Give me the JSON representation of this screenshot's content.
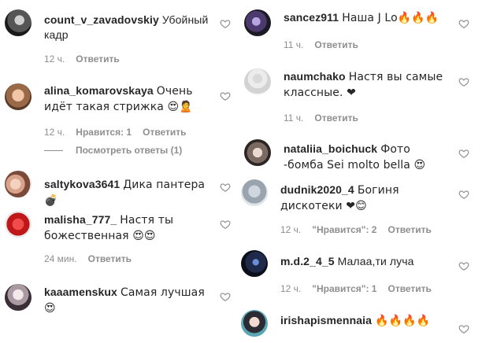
{
  "left_column": [
    {
      "username": "count_v_zavadovskiy",
      "text": "Убойный кадр",
      "time": "12 ч.",
      "likes": "",
      "reply": "Ответить"
    },
    {
      "username": "alina_komarovskaya",
      "text": "Очень идёт такая стрижка 😍🙎",
      "time": "12 ч.",
      "likes": "Нравится: 1",
      "reply": "Ответить",
      "view_replies": "Посмотреть ответы (1)"
    },
    {
      "username": "saltykova3641",
      "text": "Дика пантера💣",
      "time": "",
      "likes": "",
      "reply": ""
    },
    {
      "username": "malisha_777_",
      "text": "Настя ты божественная 😍😍",
      "time": "24 мин.",
      "likes": "",
      "reply": "Ответить"
    },
    {
      "username": "kaaamenskux",
      "text": "Самая лучшая 😍",
      "time": "",
      "likes": "",
      "reply": ""
    }
  ],
  "right_column": [
    {
      "username": "sancez911",
      "text": "Наша J Lo🔥🔥🔥",
      "time": "11 ч.",
      "likes": "",
      "reply": "Ответить"
    },
    {
      "username": "naumchako",
      "text": "Настя вы самые классные. ❤",
      "time": "11 ч.",
      "likes": "",
      "reply": "Ответить"
    },
    {
      "username": "nataliia_boichuck",
      "text": "Фото -бомба Sei molto bella 😍",
      "time": "",
      "likes": "",
      "reply": ""
    },
    {
      "username": "dudnik2020_4",
      "text": "Богиня дискотеки ❤😊",
      "time": "12 ч.",
      "likes": "\"Нравится\": 2",
      "reply": "Ответить"
    },
    {
      "username": "m.d.2_4_5",
      "text": "Малаа,ти луча",
      "time": "12 ч.",
      "likes": "\"Нравится\": 1",
      "reply": "Ответить"
    },
    {
      "username": "irishapismennaia",
      "text": "🔥🔥🔥🔥",
      "time": "",
      "likes": "",
      "reply": ""
    }
  ],
  "colors": {
    "text": "#262626",
    "muted": "#8e8e8e",
    "heart_outline": "#8e8e8e",
    "heart_red": "#ed4956"
  }
}
